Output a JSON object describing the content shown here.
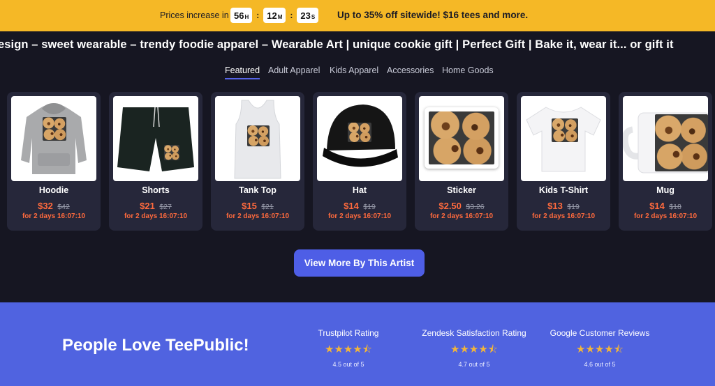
{
  "promo": {
    "lead": "Prices increase in",
    "timer": [
      {
        "value": "56",
        "unit": "H"
      },
      {
        "value": "12",
        "unit": "M"
      },
      {
        "value": "23",
        "unit": "S"
      }
    ],
    "separator": ":",
    "offer": "Up to 35% off sitewide! $16 tees and more.",
    "background": "#f5b826"
  },
  "marquee": "esign – sweet wearable – trendy foodie apparel – Wearable Art | unique cookie gift | Perfect Gift | Bake it, wear it... or gift it",
  "tabs": [
    "Featured",
    "Adult Apparel",
    "Kids Apparel",
    "Accessories",
    "Home Goods"
  ],
  "products": [
    {
      "name": "Hoodie",
      "price": "$32",
      "old_price": "$42",
      "deal": "for 2 days 16:07:10",
      "icon": "hoodie-icon"
    },
    {
      "name": "Shorts",
      "price": "$21",
      "old_price": "$27",
      "deal": "for 2 days 16:07:10",
      "icon": "shorts-icon"
    },
    {
      "name": "Tank Top",
      "price": "$15",
      "old_price": "$21",
      "deal": "for 2 days 16:07:10",
      "icon": "tank-top-icon"
    },
    {
      "name": "Hat",
      "price": "$14",
      "old_price": "$19",
      "deal": "for 2 days 16:07:10",
      "icon": "hat-icon"
    },
    {
      "name": "Sticker",
      "price": "$2.50",
      "old_price": "$3.26",
      "deal": "for 2 days 16:07:10",
      "icon": "sticker-icon"
    },
    {
      "name": "Kids T-Shirt",
      "price": "$13",
      "old_price": "$19",
      "deal": "for 2 days 16:07:10",
      "icon": "t-shirt-icon"
    },
    {
      "name": "Mug",
      "price": "$14",
      "old_price": "$18",
      "deal": "for 2 days 16:07:10",
      "icon": "mug-icon"
    }
  ],
  "view_more": "View More By This Artist",
  "love": {
    "headline": "People Love TeePublic!",
    "ratings": [
      {
        "label": "Trustpilot Rating",
        "stars": "★★★★⯪",
        "score": "4.5 out of 5"
      },
      {
        "label": "Zendesk Satisfaction Rating",
        "stars": "★★★★⯪",
        "score": "4.7 out of 5"
      },
      {
        "label": "Google Customer Reviews",
        "stars": "★★★★⯪",
        "score": "4.6 out of 5"
      }
    ]
  },
  "colors": {
    "accent": "#5063e0",
    "button": "#4e5ee6",
    "sale": "#ff6a3d",
    "star": "#f2b53a",
    "page_background": "#161622",
    "card_background": "#26273a"
  }
}
